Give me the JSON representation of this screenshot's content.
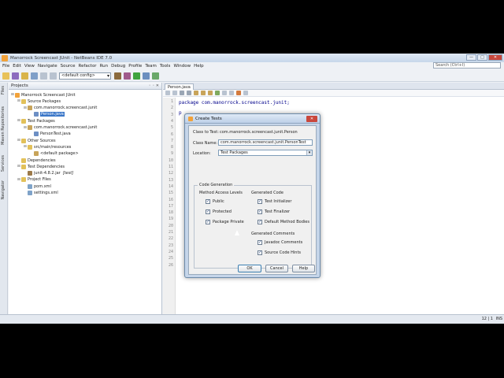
{
  "window": {
    "title": "Manorrock Screencast JUnit - NetBeans IDE 7.0",
    "controls": [
      "—",
      "□",
      "✕"
    ]
  },
  "menu": [
    "File",
    "Edit",
    "View",
    "Navigate",
    "Source",
    "Refactor",
    "Run",
    "Debug",
    "Profile",
    "Team",
    "Tools",
    "Window",
    "Help"
  ],
  "search": {
    "placeholder": "Search (Ctrl+I)"
  },
  "toolbar": {
    "config": "<default config>"
  },
  "left_strip": [
    "Files",
    "Maven Repositories",
    "Services",
    "Navigator"
  ],
  "projects_panel": {
    "title": "Projects",
    "controls": "◦ ◦ ✕",
    "tree": [
      {
        "label": "Manorrock Screencast JUnit",
        "depth": 0,
        "expanded": true,
        "icon": "project-icon"
      },
      {
        "label": "Source Packages",
        "depth": 1,
        "expanded": true,
        "icon": "folder-icon"
      },
      {
        "label": "com.manorrock.screencast.junit",
        "depth": 2,
        "expanded": true,
        "icon": "package-icon"
      },
      {
        "label": "Person.java",
        "depth": 3,
        "expanded": false,
        "icon": "java-file-icon",
        "selected": true
      },
      {
        "label": "Test Packages",
        "depth": 1,
        "expanded": true,
        "icon": "folder-icon"
      },
      {
        "label": "com.manorrock.screencast.junit",
        "depth": 2,
        "expanded": true,
        "icon": "package-icon"
      },
      {
        "label": "PersonTest.java",
        "depth": 3,
        "expanded": false,
        "icon": "java-file-icon"
      },
      {
        "label": "Other Sources",
        "depth": 1,
        "expanded": true,
        "icon": "folder-icon"
      },
      {
        "label": "src/main/resources",
        "depth": 2,
        "expanded": true,
        "icon": "folder-icon"
      },
      {
        "label": "<default package>",
        "depth": 3,
        "expanded": false,
        "icon": "package-icon"
      },
      {
        "label": "Dependencies",
        "depth": 1,
        "expanded": false,
        "icon": "folder-icon"
      },
      {
        "label": "Test Dependencies",
        "depth": 1,
        "expanded": true,
        "icon": "folder-icon"
      },
      {
        "label": "junit-4.8.2.jar",
        "suffix": "[test]",
        "depth": 2,
        "expanded": false,
        "icon": "jar-icon"
      },
      {
        "label": "Project Files",
        "depth": 1,
        "expanded": true,
        "icon": "folder-icon"
      },
      {
        "label": "pom.xml",
        "depth": 2,
        "expanded": false,
        "icon": "xml-file-icon"
      },
      {
        "label": "settings.xml",
        "depth": 2,
        "expanded": false,
        "icon": "xml-file-icon"
      }
    ]
  },
  "editor": {
    "tab": "Person.java",
    "line_numbers": [
      "1",
      "2",
      "3",
      "4",
      "5",
      "6",
      "7",
      "8",
      "9",
      "10",
      "11",
      "12",
      "13",
      "14",
      "15",
      "16",
      "17",
      "18",
      "19",
      "20",
      "21",
      "22",
      "23",
      "24",
      "25",
      "26"
    ],
    "code_line_1": "package com.manorrock.screencast.junit;",
    "code_line_3": "p"
  },
  "status": {
    "position": "12 | 1",
    "mode": "INS"
  },
  "dialog": {
    "title": "Create Tests",
    "class_to_test_label": "Class to Test:",
    "class_to_test_value": "com.manorrock.screencast.junit.Person",
    "class_name_label": "Class Name:",
    "class_name_value": "com.manorrock.screencast.junit.PersonTest",
    "location_label": "Location:",
    "location_value": "Test Packages",
    "group_title": "Code Generation",
    "method_access_title": "Method Access Levels",
    "generated_code_title": "Generated Code",
    "generated_comments_title": "Generated Comments",
    "checkboxes": {
      "public": "Public",
      "protected": "Protected",
      "package_private": "Package Private",
      "test_initializer": "Test Initializer",
      "test_finalizer": "Test Finalizer",
      "default_method_bodies": "Default Method Bodies",
      "javadoc_comments": "Javadoc Comments",
      "source_code_hints": "Source Code Hints"
    },
    "check_mark": "✓",
    "ok": "OK",
    "cancel": "Cancel",
    "help": "Help"
  }
}
